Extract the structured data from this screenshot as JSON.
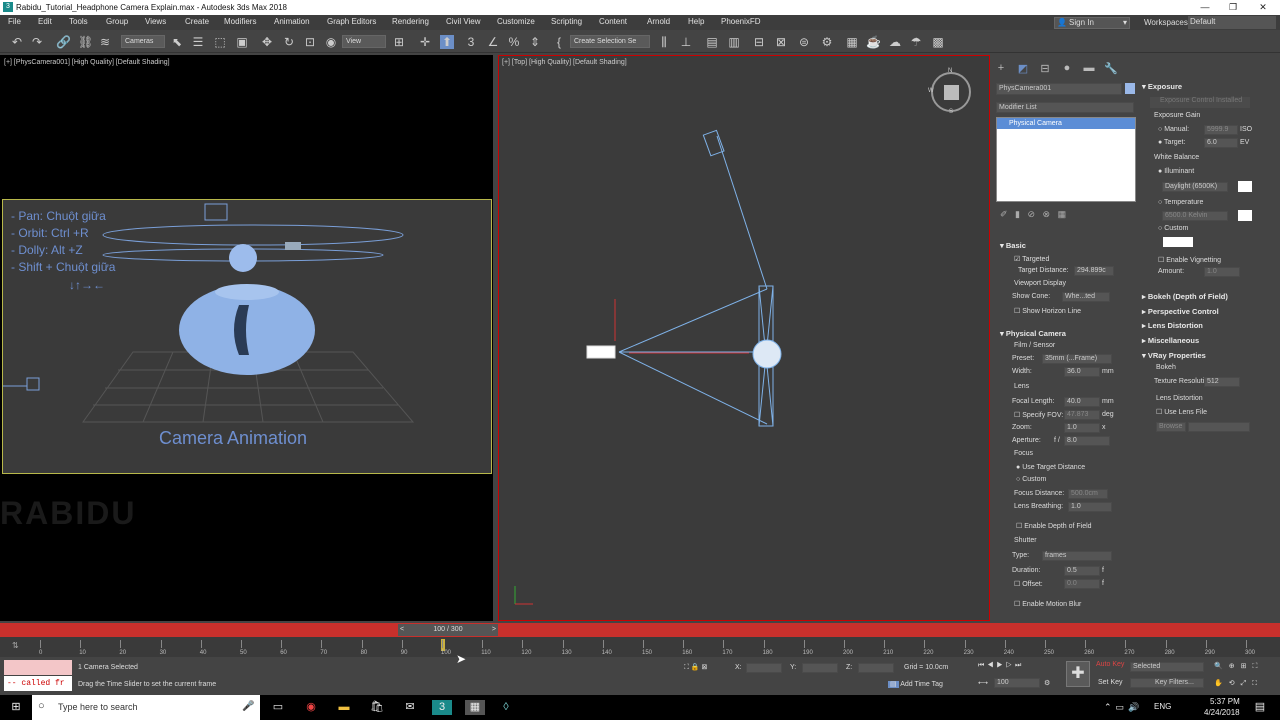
{
  "window": {
    "title": "Rabidu_Tutorial_Headphone Camera Explain.max - Autodesk 3ds Max 2018",
    "app_icon": "3",
    "minimize": "—",
    "maximize": "❐",
    "close": "✕"
  },
  "menu": [
    "File",
    "Edit",
    "Tools",
    "Group",
    "Views",
    "Create",
    "Modifiers",
    "Animation",
    "Graph Editors",
    "Rendering",
    "Civil View",
    "Customize",
    "Scripting",
    "Content",
    "Arnold",
    "Help",
    "PhoenixFD"
  ],
  "account": {
    "sign_in": "Sign In",
    "workspaces_label": "Workspaces:",
    "workspace": "Default"
  },
  "toolbar": {
    "filter": "Cameras",
    "refcoord": "View",
    "selection_set": "Create Selection Se"
  },
  "viewport_left": {
    "label": "[+] [PhysCamera001] [High Quality] [Default Shading]",
    "help": [
      "- Pan: Chuột giữa",
      "- Orbit: Ctrl +R",
      "- Dolly: Alt +Z",
      "- Shift + Chuột giữa",
      "↓↑→←"
    ],
    "caption": "Camera Animation",
    "watermark": "RABIDU"
  },
  "viewport_right": {
    "label": "[+] [Top] [High Quality] [Default Shading]",
    "viewcube": {
      "n": "N",
      "w": "W",
      "s": "S"
    }
  },
  "cmd": {
    "object_name": "PhysCamera001",
    "modifier_list": "Modifier List",
    "stack_item": "Physical Camera",
    "basic": {
      "header": "Basic",
      "targeted": "Targeted",
      "target_distance_label": "Target Distance:",
      "target_distance": "294.899c",
      "viewport_display": "Viewport Display",
      "show_cone_label": "Show Cone:",
      "show_cone": "Whe...ted",
      "show_horizon": "Show Horizon Line"
    },
    "physical": {
      "header": "Physical Camera",
      "film_sensor": "Film / Sensor",
      "preset_label": "Preset:",
      "preset": "35mm (...Frame)",
      "width_label": "Width:",
      "width": "36.0",
      "width_unit": "mm",
      "lens": "Lens",
      "focal_label": "Focal Length:",
      "focal": "40.0",
      "focal_unit": "mm",
      "specify_fov": "Specify FOV:",
      "fov": "47.873",
      "fov_unit": "deg",
      "zoom_label": "Zoom:",
      "zoom": "1.0",
      "zoom_unit": "x",
      "aperture_label": "Aperture:",
      "aperture_f": "f /",
      "aperture": "8.0",
      "focus": "Focus",
      "use_target": "Use Target Distance",
      "custom": "Custom",
      "focus_distance_label": "Focus Distance:",
      "focus_distance": "500.0cm",
      "lens_breathing_label": "Lens Breathing:",
      "lens_breathing": "1.0",
      "enable_dof": "Enable Depth of Field",
      "shutter": "Shutter",
      "type_label": "Type:",
      "type": "frames",
      "duration_label": "Duration:",
      "duration": "0.5",
      "duration_unit": "f",
      "offset_label": "Offset:",
      "offset": "0.0",
      "offset_unit": "f",
      "enable_mb": "Enable Motion Blur"
    },
    "exposure": {
      "header": "Exposure",
      "control_installed": "Exposure Control Installed",
      "gain": "Exposure Gain",
      "manual": "Manual:",
      "manual_val": "5999.9",
      "manual_unit": "ISO",
      "target": "Target:",
      "target_val": "6.0",
      "target_unit": "EV",
      "wb": "White Balance",
      "illuminant": "Illuminant",
      "daylight": "Daylight (6500K)",
      "temperature": "Temperature",
      "temp_val": "6500.0",
      "temp_unit": "Kelvin",
      "custom": "Custom",
      "vignetting": "Enable Vignetting",
      "amount": "Amount:",
      "amount_val": "1.0"
    },
    "rollouts": [
      "Bokeh (Depth of Field)",
      "Perspective Control",
      "Lens Distortion",
      "Miscellaneous",
      "VRay Properties"
    ],
    "vray": {
      "bokeh": "Bokeh",
      "texture_res": "Texture Resolution",
      "texture_val": "512",
      "lens_distortion": "Lens Distortion",
      "use_lens_file": "Use Lens File",
      "browse": "Browse"
    }
  },
  "timeline": {
    "slider": "100 / 300",
    "ticks": [
      "0",
      "10",
      "20",
      "30",
      "40",
      "50",
      "60",
      "70",
      "80",
      "90",
      "100",
      "110",
      "120",
      "130",
      "140",
      "150",
      "160",
      "170",
      "180",
      "190",
      "200",
      "210",
      "220",
      "230",
      "240",
      "250",
      "260",
      "270",
      "280",
      "290",
      "300"
    ]
  },
  "status": {
    "script_text": "-- called fr",
    "selected": "1 Camera Selected",
    "prompt": "Drag the Time Slider to set the current frame",
    "x": "X:",
    "y": "Y:",
    "z": "Z:",
    "grid": "Grid = 10.0cm",
    "add_time_tag": "Add Time Tag",
    "auto_key": "Auto Key",
    "set_key": "Set Key",
    "selected_dd": "Selected",
    "key_filters": "Key Filters...",
    "frame": "100"
  },
  "taskbar": {
    "search": "Type here to search",
    "lang": "ENG",
    "time": "5:37 PM",
    "date": "4/24/2018"
  },
  "colors": {
    "timebar": "#c8302c",
    "safe_frame": "#b8b84a",
    "help_text": "#6e8fd0",
    "stack_selected": "#5b8dd6",
    "viewport_border": "#cc0000"
  }
}
